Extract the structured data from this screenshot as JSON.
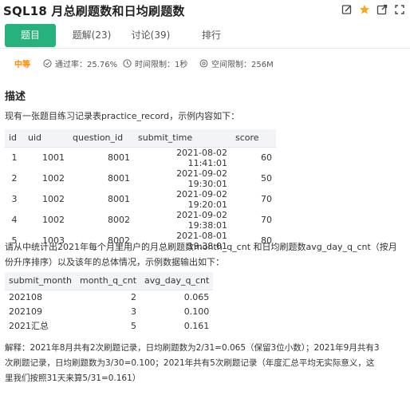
{
  "header": {
    "title": "SQL18  月总刷题数和日均刷题数",
    "icons": [
      "edit-icon",
      "star-icon",
      "external-link-icon",
      "expand-icon"
    ],
    "star_color": "#f5a623"
  },
  "tabs": [
    {
      "label": "题目",
      "active": true
    },
    {
      "label": "题解(23)",
      "active": false
    },
    {
      "label": "讨论(39)",
      "active": false
    },
    {
      "label": "排行",
      "active": false
    }
  ],
  "meta": {
    "difficulty": "中等",
    "pass_rate": "通过率：25.76%",
    "time_limit": "时间限制：1秒",
    "space_limit": "空间限制：256M"
  },
  "description": {
    "heading": "描述",
    "intro": "现有一张题目练习记录表practice_record，示例内容如下：",
    "table1": {
      "headers": [
        "id",
        "uid",
        "question_id",
        "submit_time",
        "score"
      ],
      "rows": [
        [
          "1",
          "1001",
          "8001",
          "2021-08-02 11:41:01",
          "60"
        ],
        [
          "2",
          "1002",
          "8001",
          "2021-09-02 19:30:01",
          "50"
        ],
        [
          "3",
          "1002",
          "8001",
          "2021-09-02 19:20:01",
          "70"
        ],
        [
          "4",
          "1002",
          "8002",
          "2021-09-02 19:38:01",
          "70"
        ],
        [
          "5",
          "1003",
          "8002",
          "2021-08-01 19:38:01",
          "80"
        ]
      ]
    },
    "question_line1": "请从中统计出2021年每个月里用户的月总刷题数month_q_cnt 和日均刷题数avg_day_q_cnt（按月",
    "question_line2": "份升序排序）以及该年的总体情况，示例数据输出如下：",
    "table2": {
      "headers": [
        "submit_month",
        "month_q_cnt",
        "avg_day_q_cnt"
      ],
      "rows": [
        [
          "202108",
          "2",
          "0.065"
        ],
        [
          "202109",
          "3",
          "0.100"
        ],
        [
          "2021汇总",
          "5",
          "0.161"
        ]
      ]
    },
    "note_line1": "解释：2021年8月共有2次刷题记录，日均刷题数为2/31=0.065（保留3位小数）；2021年9月共有3",
    "note_line2": "次刷题记录，日均刷题数为3/30=0.100；2021年共有5次刷题记录（年度汇总平均无实际意义，这",
    "note_line3": "里我们按照31天来算5/31=0.161）"
  },
  "colors": {
    "accent": "#27b17c",
    "difficulty": "#ff8a00"
  }
}
